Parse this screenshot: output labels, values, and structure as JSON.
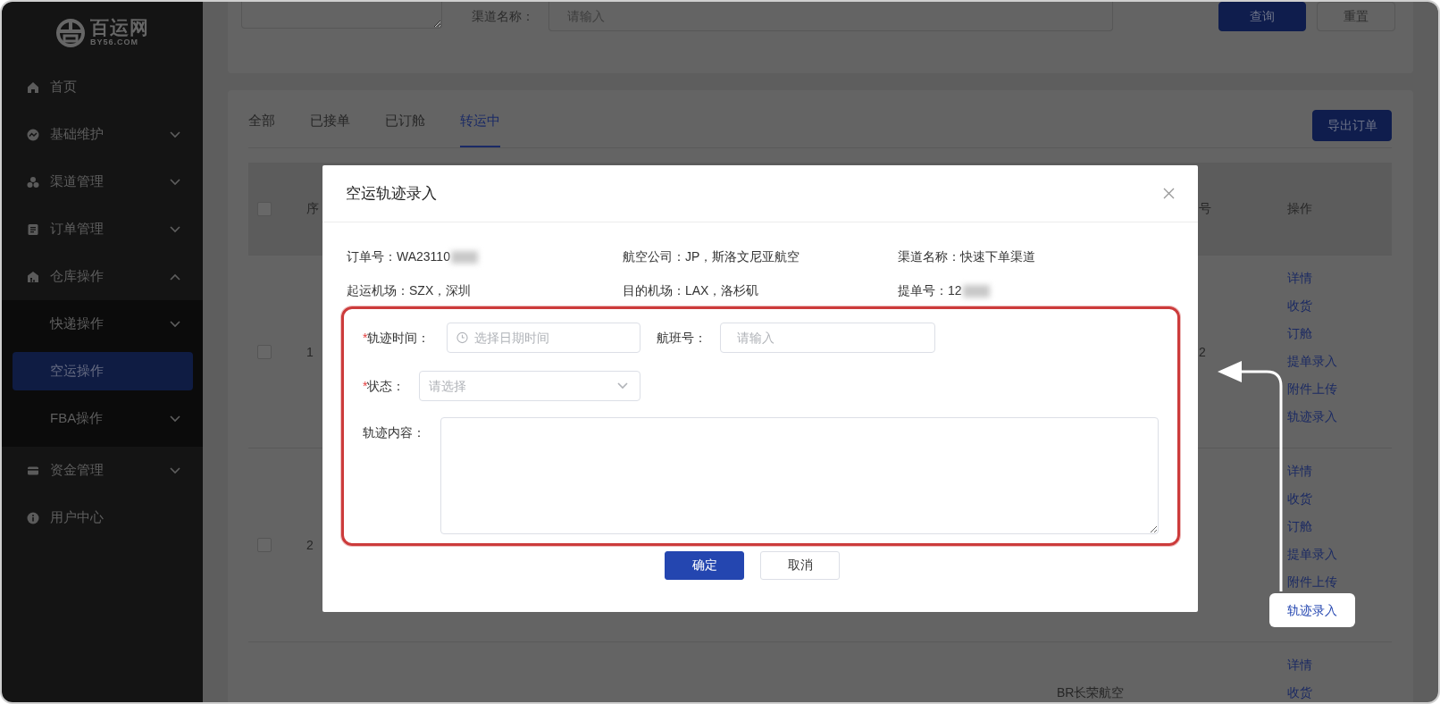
{
  "sidebar": {
    "logo": {
      "name": "百运网",
      "domain": "BY56.COM"
    },
    "items": [
      {
        "label": "首页",
        "kind": "link",
        "expanded": false,
        "selected": false
      },
      {
        "label": "基础维护",
        "kind": "group",
        "expanded": false,
        "selected": false
      },
      {
        "label": "渠道管理",
        "kind": "group",
        "expanded": false,
        "selected": false
      },
      {
        "label": "订单管理",
        "kind": "group",
        "expanded": false,
        "selected": false
      },
      {
        "label": "仓库操作",
        "kind": "group",
        "expanded": true,
        "selected": false,
        "children": [
          {
            "label": "快递操作",
            "kind": "group",
            "expanded": false,
            "selected": false
          },
          {
            "label": "空运操作",
            "kind": "link",
            "expanded": false,
            "selected": true
          },
          {
            "label": "FBA操作",
            "kind": "group",
            "expanded": false,
            "selected": false
          }
        ]
      },
      {
        "label": "资金管理",
        "kind": "group",
        "expanded": false,
        "selected": false
      },
      {
        "label": "用户中心",
        "kind": "link",
        "expanded": false,
        "selected": false
      }
    ]
  },
  "filter": {
    "channel_name": {
      "label": "渠道名称：",
      "placeholder": "请输入"
    },
    "buttons": [
      {
        "label": "查询",
        "kind": "primary"
      },
      {
        "label": "重置",
        "kind": "default"
      }
    ]
  },
  "tabs": [
    {
      "label": "全部",
      "selected": false
    },
    {
      "label": "已接单",
      "selected": false
    },
    {
      "label": "已订舱",
      "selected": false
    },
    {
      "label": "转运中",
      "selected": true
    }
  ],
  "export_button": "导出订单",
  "table": {
    "header_checked": false,
    "columns": [
      "序",
      "号",
      "操作"
    ],
    "rows": [
      {
        "checked": false,
        "seq": "1",
        "column_4": "2",
        "operations": [
          {
            "label": "详情",
            "highlighted": false
          },
          {
            "label": "收货",
            "highlighted": false
          },
          {
            "label": "订舱",
            "highlighted": false
          },
          {
            "label": "提单录入",
            "highlighted": false
          },
          {
            "label": "附件上传",
            "highlighted": false
          },
          {
            "label": "轨迹录入",
            "highlighted": false
          }
        ]
      },
      {
        "checked": false,
        "seq": "2",
        "operations": [
          {
            "label": "详情",
            "highlighted": false
          },
          {
            "label": "收货",
            "highlighted": false
          },
          {
            "label": "订舱",
            "highlighted": false
          },
          {
            "label": "提单录入",
            "highlighted": false
          },
          {
            "label": "附件上传",
            "highlighted": false
          },
          {
            "label": "轨迹录入",
            "highlighted": true
          }
        ]
      },
      {
        "column_3": "BR长荣航空",
        "operations": [
          {
            "label": "详情",
            "highlighted": false
          },
          {
            "label": "收货",
            "highlighted": false
          }
        ]
      }
    ]
  },
  "modal": {
    "title": "空运轨迹录入",
    "info": [
      {
        "label": "订单号：",
        "value": "WA23110",
        "redacted": true
      },
      {
        "label": "航空公司：",
        "value": "JP，斯洛文尼亚航空",
        "redacted": false
      },
      {
        "label": "渠道名称：",
        "value": "快速下单渠道",
        "redacted": false
      },
      {
        "label": "起运机场：",
        "value": "SZX，深圳",
        "redacted": false
      },
      {
        "label": "目的机场：",
        "value": "LAX，洛杉矶",
        "redacted": false
      },
      {
        "label": "提单号：",
        "value": "12",
        "redacted": true
      }
    ],
    "required_mark": "*",
    "form_rows": [
      [
        {
          "kind": "datetime",
          "label": "轨迹时间：",
          "required": true,
          "placeholder": "选择日期时间"
        },
        {
          "kind": "text",
          "label": "航班号：",
          "required": false,
          "placeholder": "请输入"
        }
      ],
      [
        {
          "kind": "select",
          "label": "状态：",
          "required": true,
          "placeholder": "请选择"
        }
      ],
      [
        {
          "kind": "textarea",
          "label": "轨迹内容：",
          "required": false
        }
      ]
    ],
    "buttons": [
      {
        "label": "确定",
        "kind": "primary"
      },
      {
        "label": "取消",
        "kind": "default"
      }
    ]
  }
}
